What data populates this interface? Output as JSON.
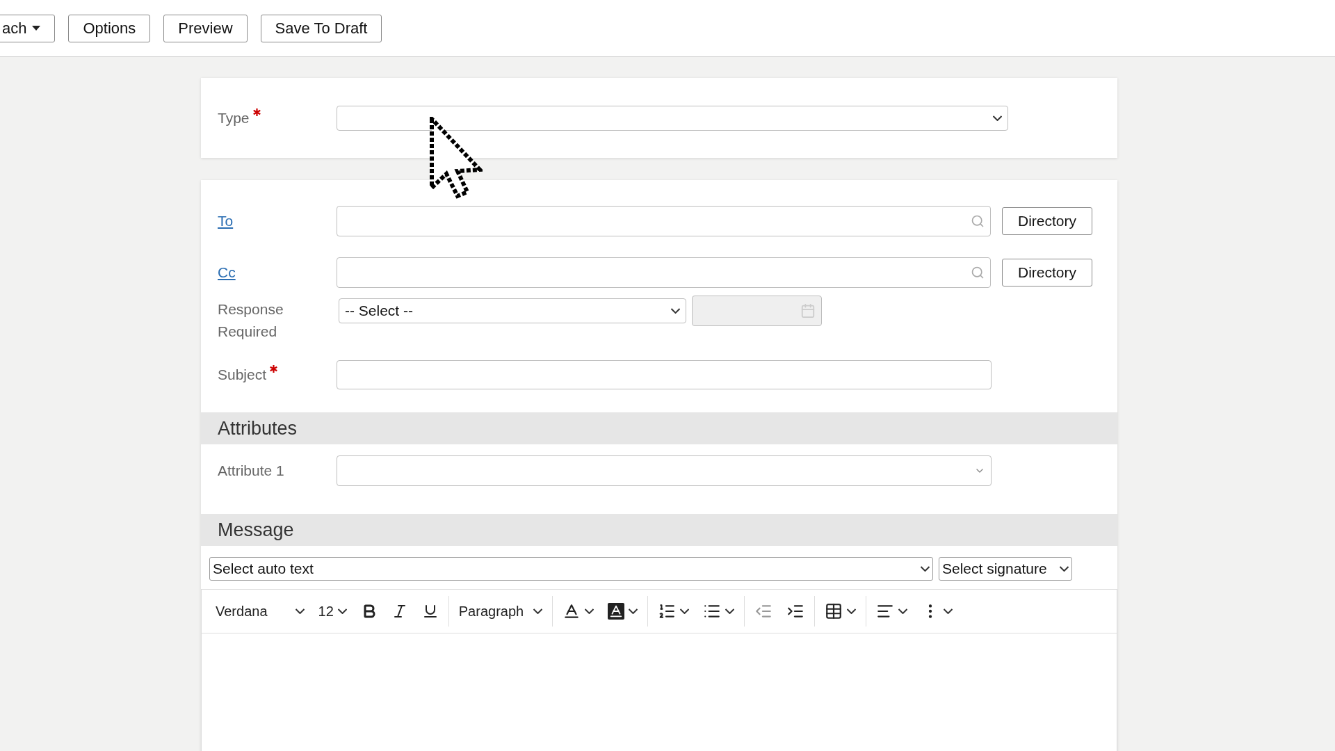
{
  "top_toolbar": {
    "buttons": [
      {
        "label": "ach",
        "kind": "dropdown"
      },
      {
        "label": "Options",
        "kind": "plain"
      },
      {
        "label": "Preview",
        "kind": "plain"
      },
      {
        "label": "Save To Draft",
        "kind": "plain"
      }
    ]
  },
  "type_field": {
    "label": "Type",
    "required": true
  },
  "recipients": [
    {
      "label": "To",
      "button": "Directory"
    },
    {
      "label": "Cc",
      "button": "Directory"
    }
  ],
  "response_required": {
    "label": "Response Required",
    "value": "-- Select --"
  },
  "subject": {
    "label": "Subject",
    "required": true
  },
  "attributes": {
    "heading": "Attributes",
    "fields": [
      {
        "label": "Attribute 1"
      }
    ]
  },
  "message": {
    "heading": "Message",
    "auto_text": "Select auto text",
    "signature": "Select signature",
    "editor_toolbar": {
      "font": "Verdana",
      "size": "12",
      "block": "Paragraph"
    }
  }
}
